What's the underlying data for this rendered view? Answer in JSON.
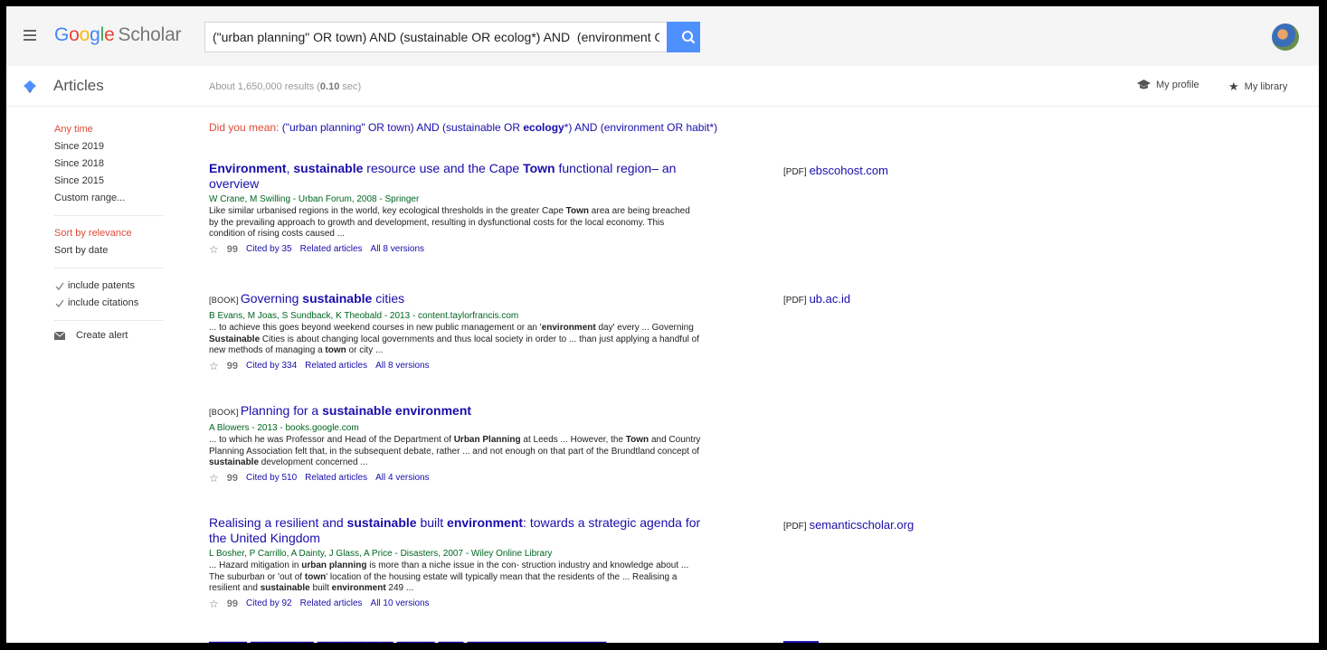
{
  "header": {
    "logo_google": "Google",
    "logo_scholar": "Scholar",
    "search_value": "(\"urban planning\" OR town) AND (sustainable OR ecolog*) AND  (environment OR habit*)",
    "accent": "#4d90fe"
  },
  "subheader": {
    "articles_label": "Articles",
    "results_prefix": "About 1,650,000 results (",
    "results_time": "0.10",
    "results_suffix": " sec)",
    "my_profile": "My profile",
    "my_library": "My library"
  },
  "sidebar": {
    "time_filters": [
      "Any time",
      "Since 2019",
      "Since 2018",
      "Since 2015",
      "Custom range..."
    ],
    "sort_options": [
      "Sort by relevance",
      "Sort by date"
    ],
    "checks": [
      "include patents",
      "include citations"
    ],
    "create_alert": "Create alert"
  },
  "did_you_mean": {
    "label": "Did you mean:",
    "q1": " (\"urban planning\" OR town) AND (sustainable OR ",
    "q_bold": "ecology",
    "q2": "*) AND (environment OR habit*)"
  },
  "results": [
    {
      "tag": "",
      "title_parts": [
        {
          "t": "Environment",
          "b": true
        },
        {
          "t": ", ",
          "b": false
        },
        {
          "t": "sustainable",
          "b": true
        },
        {
          "t": " resource use and the Cape ",
          "b": false
        },
        {
          "t": "Town",
          "b": true
        },
        {
          "t": " functional region– an overview",
          "b": false
        }
      ],
      "authors": "W Crane, M Swilling - Urban Forum, 2008 - Springer",
      "snippet_parts": [
        {
          "t": "Like similar urbanised regions in the world, key ecological thresholds in the greater Cape ",
          "b": false
        },
        {
          "t": "Town",
          "b": true
        },
        {
          "t": " area are being breached by the prevailing approach to growth and development, resulting in dysfunctional costs for the local economy. This condition of rising costs caused ...",
          "b": false
        }
      ],
      "cited": "Cited by 35",
      "related": "Related articles",
      "versions": "All 8 versions",
      "pdf_tag": "[PDF]",
      "pdf_source": "ebscohost.com"
    },
    {
      "tag": "[BOOK]",
      "title_parts": [
        {
          "t": "Governing ",
          "b": false
        },
        {
          "t": "sustainable",
          "b": true
        },
        {
          "t": " cities",
          "b": false
        }
      ],
      "authors": "B Evans, M Joas, S Sundback, K Theobald - 2013 - content.taylorfrancis.com",
      "snippet_parts": [
        {
          "t": "... to achieve this goes beyond weekend courses in new public management or an '",
          "b": false
        },
        {
          "t": "environment",
          "b": true
        },
        {
          "t": " day' every ... Governing ",
          "b": false
        },
        {
          "t": "Sustainable",
          "b": true
        },
        {
          "t": " Cities is about changing local governments and thus local society in order to ... than just applying a handful of new methods of managing a ",
          "b": false
        },
        {
          "t": "town",
          "b": true
        },
        {
          "t": " or city ...",
          "b": false
        }
      ],
      "cited": "Cited by 334",
      "related": "Related articles",
      "versions": "All 8 versions",
      "pdf_tag": "[PDF]",
      "pdf_source": "ub.ac.id"
    },
    {
      "tag": "[BOOK]",
      "title_parts": [
        {
          "t": "Planning for a ",
          "b": false
        },
        {
          "t": "sustainable environment",
          "b": true
        }
      ],
      "authors": "A Blowers - 2013 - books.google.com",
      "snippet_parts": [
        {
          "t": "... to which he was Professor and Head of the Department of ",
          "b": false
        },
        {
          "t": "Urban Planning",
          "b": true
        },
        {
          "t": " at Leeds ... However, the ",
          "b": false
        },
        {
          "t": "Town",
          "b": true
        },
        {
          "t": " and Country Planning Association felt that, in the subsequent debate, rather ... and not enough on that part of the Brundtland concept of ",
          "b": false
        },
        {
          "t": "sustainable",
          "b": true
        },
        {
          "t": " development concerned ...",
          "b": false
        }
      ],
      "cited": "Cited by 510",
      "related": "Related articles",
      "versions": "All 4 versions",
      "pdf_tag": "",
      "pdf_source": ""
    },
    {
      "tag": "",
      "title_parts": [
        {
          "t": "Realising a resilient and ",
          "b": false
        },
        {
          "t": "sustainable",
          "b": true
        },
        {
          "t": " built ",
          "b": false
        },
        {
          "t": "environment",
          "b": true
        },
        {
          "t": ": towards a strategic agenda for the United Kingdom",
          "b": false
        }
      ],
      "authors": "L Bosher, P Carrillo, A Dainty, J Glass, A Price - Disasters, 2007 - Wiley Online Library",
      "snippet_parts": [
        {
          "t": "... Hazard mitigation in ",
          "b": false
        },
        {
          "t": "urban planning",
          "b": true
        },
        {
          "t": " is more than a niche issue in the con- struction industry and knowledge about ... The suburban or 'out of ",
          "b": false
        },
        {
          "t": "town",
          "b": true
        },
        {
          "t": "' location of the housing estate will typically mean that the residents of the ... Realising a resilient and ",
          "b": false
        },
        {
          "t": "sustainable",
          "b": true
        },
        {
          "t": " built ",
          "b": false
        },
        {
          "t": "environment",
          "b": true
        },
        {
          "t": " 249 ...",
          "b": false
        }
      ],
      "cited": "Cited by 92",
      "related": "Related articles",
      "versions": "All 10 versions",
      "pdf_tag": "[PDF]",
      "pdf_source": "semanticscholar.org"
    }
  ]
}
